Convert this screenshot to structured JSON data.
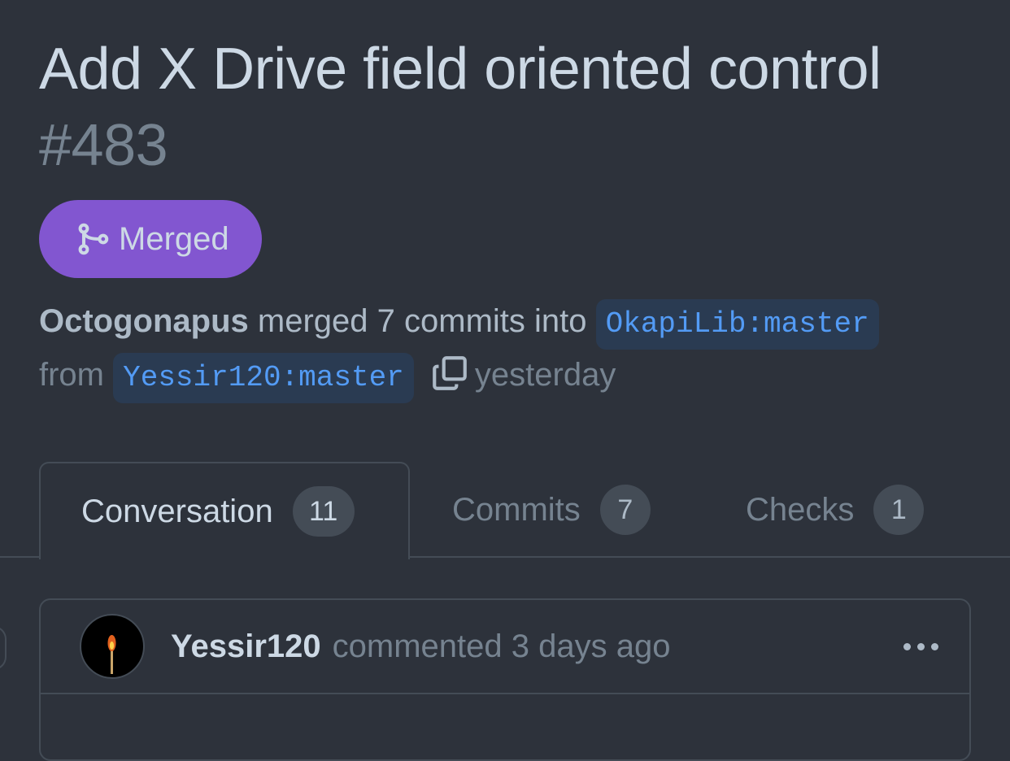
{
  "pr": {
    "title": "Add X Drive field oriented control",
    "number": "#483",
    "state": "Merged",
    "author": "Octogonapus",
    "merged_text": "merged 7 commits into",
    "base_branch": "OkapiLib:master",
    "from_text": "from",
    "head_branch": "Yessir120:master",
    "time": "yesterday"
  },
  "tabs": [
    {
      "label": "Conversation",
      "count": "11"
    },
    {
      "label": "Commits",
      "count": "7"
    },
    {
      "label": "Checks",
      "count": "1"
    }
  ],
  "comment": {
    "author": "Yessir120",
    "meta": "commented 3 days ago"
  },
  "colors": {
    "background": "#2d323b",
    "merged_badge": "#8256d0",
    "branch_text": "#539bf5",
    "branch_bg": "#2a3b52",
    "border": "#444c56"
  },
  "icons": {
    "state": "git-merge-icon",
    "copy": "copy-icon",
    "menu": "kebab-horizontal-icon",
    "avatar": "match-flame-avatar"
  }
}
